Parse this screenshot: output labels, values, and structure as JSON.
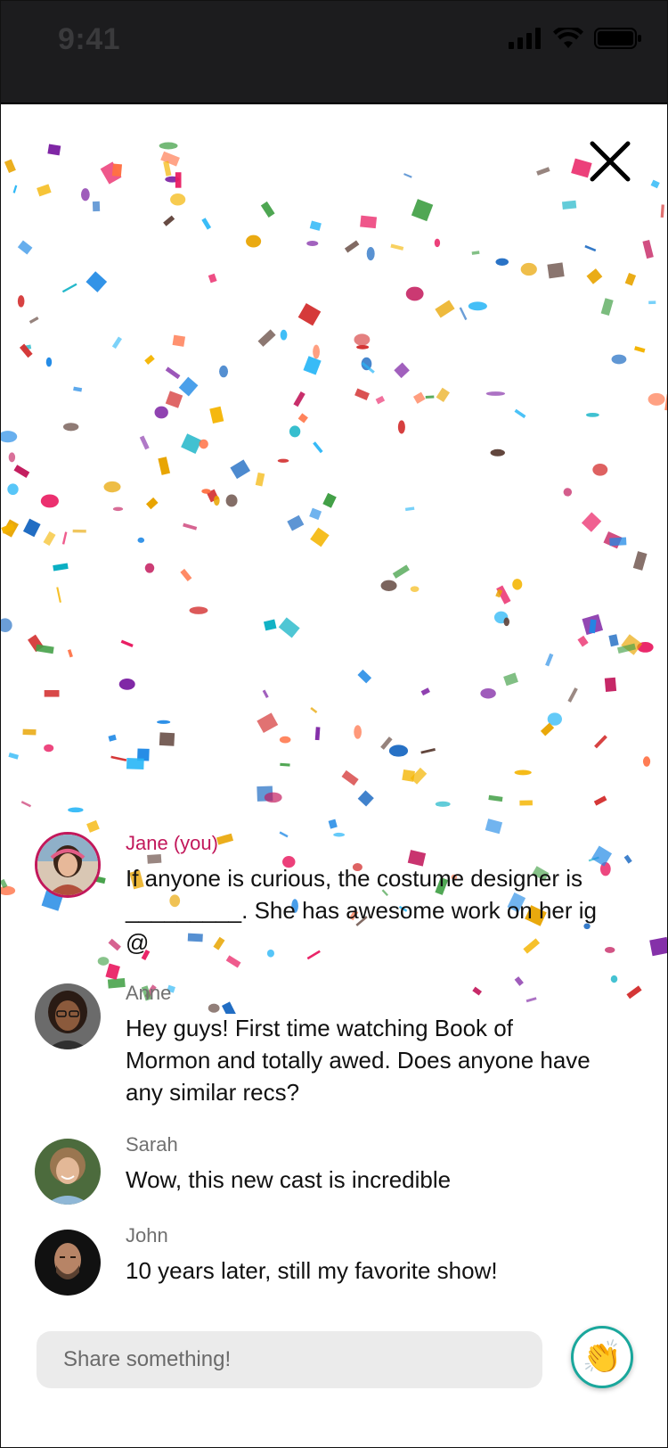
{
  "status_bar": {
    "time": "9:41"
  },
  "close": {
    "icon": "close-icon"
  },
  "comments": [
    {
      "author": "Jane (you)",
      "is_self": true,
      "lines": [
        "If anyone is curious, the costume designer is",
        "_________. She has awesome work on her ig",
        "@"
      ]
    },
    {
      "author": "Anne",
      "is_self": false,
      "lines": [
        "Hey guys! First time watching Book of",
        "Mormon and totally awed. Does anyone have",
        "any similar recs?"
      ]
    },
    {
      "author": "Sarah",
      "is_self": false,
      "lines": [
        "Wow, this new cast is incredible"
      ]
    },
    {
      "author": "John",
      "is_self": false,
      "lines": [
        "10 years later, still my favorite show!"
      ]
    }
  ],
  "composer": {
    "placeholder": "Share something!",
    "reaction_icon": "clapping-hands-icon",
    "reaction_glyph": "👏"
  },
  "colors": {
    "self_name": "#c2185b",
    "reaction_border": "#1aa79c",
    "status_bar_bg": "#1c1c1e"
  }
}
